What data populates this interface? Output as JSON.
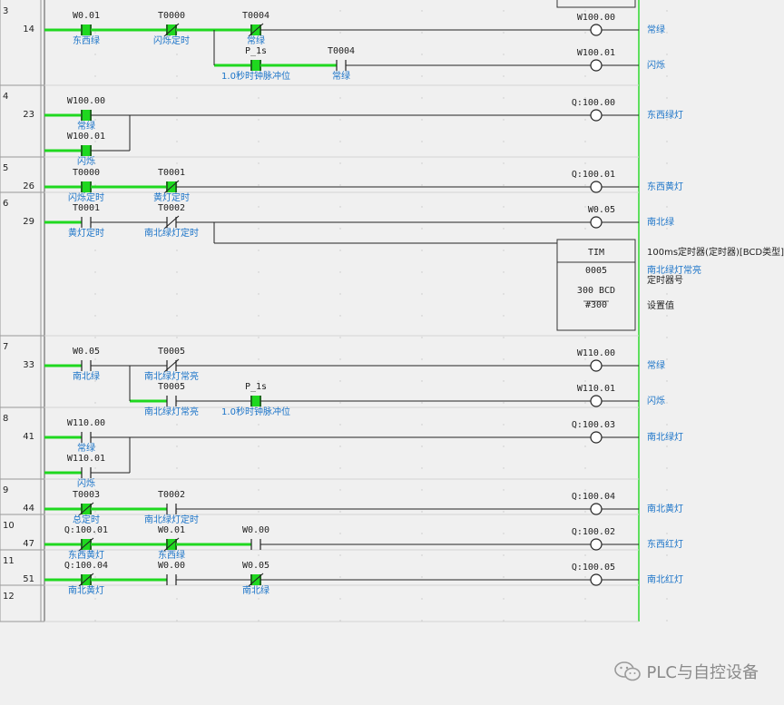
{
  "rungs": [
    {
      "id": "3",
      "step": "14",
      "elements": [
        {
          "kind": "contact",
          "row": 0,
          "col": 0,
          "addr": "W0.01",
          "cmt": "东西绿",
          "energized": true
        },
        {
          "kind": "nc",
          "row": 0,
          "col": 1,
          "addr": "T0000",
          "cmt": "闪烁定时",
          "energized": true
        },
        {
          "kind": "nc",
          "row": 0,
          "col": 2,
          "addr": "T0004",
          "cmt": "常绿",
          "energized": true
        },
        {
          "kind": "coil",
          "row": 0,
          "addr": "W100.00",
          "rcmt": "常绿"
        },
        {
          "kind": "contact",
          "row": 1,
          "col": 2,
          "addr": "P_1s",
          "cmt": "1.0秒时钟脉冲位",
          "energized": true
        },
        {
          "kind": "contact",
          "row": 1,
          "col": 3,
          "addr": "T0004",
          "cmt": "常绿",
          "energized": false
        },
        {
          "kind": "coil",
          "row": 1,
          "addr": "W100.01",
          "rcmt": "闪烁"
        }
      ]
    },
    {
      "id": "4",
      "step": "23",
      "elements": [
        {
          "kind": "contact",
          "row": 0,
          "col": 0,
          "addr": "W100.00",
          "cmt": "常绿",
          "energized": true
        },
        {
          "kind": "contact",
          "row": 1,
          "col": 0,
          "addr": "W100.01",
          "cmt": "闪烁",
          "energized": true
        },
        {
          "kind": "coil",
          "row": 0,
          "addr": "Q:100.00",
          "rcmt": "东西绿灯"
        }
      ]
    },
    {
      "id": "5",
      "step": "26",
      "elements": [
        {
          "kind": "contact",
          "row": 0,
          "col": 0,
          "addr": "T0000",
          "cmt": "闪烁定时",
          "energized": true
        },
        {
          "kind": "nc",
          "row": 0,
          "col": 1,
          "addr": "T0001",
          "cmt": "黄灯定时",
          "energized": true
        },
        {
          "kind": "coil",
          "row": 0,
          "addr": "Q:100.01",
          "rcmt": "东西黄灯"
        }
      ]
    },
    {
      "id": "6",
      "step": "29",
      "elements": [
        {
          "kind": "contact",
          "row": 0,
          "col": 0,
          "addr": "T0001",
          "cmt": "黄灯定时",
          "energized": false
        },
        {
          "kind": "nc",
          "row": 0,
          "col": 1,
          "addr": "T0002",
          "cmt": "南北绿灯定时",
          "energized": false
        },
        {
          "kind": "coil",
          "row": 0,
          "addr": "W0.05",
          "rcmt": "南北绿"
        }
      ]
    },
    {
      "id": "7",
      "step": "33",
      "elements": [
        {
          "kind": "contact",
          "row": 0,
          "col": 0,
          "addr": "W0.05",
          "cmt": "南北绿",
          "energized": false
        },
        {
          "kind": "nc",
          "row": 0,
          "col": 1,
          "addr": "T0005",
          "cmt": "南北绿灯常亮",
          "energized": false
        },
        {
          "kind": "coil",
          "row": 0,
          "addr": "W110.00",
          "rcmt": "常绿"
        },
        {
          "kind": "contact",
          "row": 1,
          "col": 1,
          "addr": "T0005",
          "cmt": "南北绿灯常亮",
          "energized": false
        },
        {
          "kind": "contact",
          "row": 1,
          "col": 2,
          "addr": "P_1s",
          "cmt": "1.0秒时钟脉冲位",
          "energized": true
        },
        {
          "kind": "coil",
          "row": 1,
          "addr": "W110.01",
          "rcmt": "闪烁"
        }
      ]
    },
    {
      "id": "8",
      "step": "41",
      "elements": [
        {
          "kind": "contact",
          "row": 0,
          "col": 0,
          "addr": "W110.00",
          "cmt": "常绿",
          "energized": false
        },
        {
          "kind": "contact",
          "row": 1,
          "col": 0,
          "addr": "W110.01",
          "cmt": "闪烁",
          "energized": false
        },
        {
          "kind": "coil",
          "row": 0,
          "addr": "Q:100.03",
          "rcmt": "南北绿灯"
        }
      ]
    },
    {
      "id": "9",
      "step": "44",
      "elements": [
        {
          "kind": "nc",
          "row": 0,
          "col": 0,
          "addr": "T0003",
          "cmt": "总定时",
          "energized": true
        },
        {
          "kind": "contact",
          "row": 0,
          "col": 1,
          "addr": "T0002",
          "cmt": "南北绿灯定时",
          "energized": false
        },
        {
          "kind": "coil",
          "row": 0,
          "addr": "Q:100.04",
          "rcmt": "南北黄灯"
        }
      ]
    },
    {
      "id": "10",
      "step": "47",
      "elements": [
        {
          "kind": "nc",
          "row": 0,
          "col": 0,
          "addr": "Q:100.01",
          "cmt": "东西黄灯",
          "energized": true
        },
        {
          "kind": "nc",
          "row": 0,
          "col": 1,
          "addr": "W0.01",
          "cmt": "东西绿",
          "energized": true
        },
        {
          "kind": "contact",
          "row": 0,
          "col": 2,
          "addr": "W0.00",
          "cmt": "",
          "energized": false
        },
        {
          "kind": "coil",
          "row": 0,
          "addr": "Q:100.02",
          "rcmt": "东西红灯"
        }
      ]
    },
    {
      "id": "11",
      "step": "51",
      "elements": [
        {
          "kind": "nc",
          "row": 0,
          "col": 0,
          "addr": "Q:100.04",
          "cmt": "南北黄灯",
          "energized": true
        },
        {
          "kind": "contact",
          "row": 0,
          "col": 1,
          "addr": "W0.00",
          "cmt": "",
          "energized": false
        },
        {
          "kind": "nc",
          "row": 0,
          "col": 2,
          "addr": "W0.05",
          "cmt": "南北绿",
          "energized": true
        },
        {
          "kind": "coil",
          "row": 0,
          "addr": "Q:100.05",
          "rcmt": "南北红灯"
        }
      ]
    },
    {
      "id": "12",
      "step": "",
      "elements": []
    }
  ],
  "timer_block": {
    "instr": "TIM",
    "num": "0005",
    "set": "300 BCD",
    "preset": "#300",
    "desc": "100ms定时器(定时器)[BCD类型]",
    "num_cmt": "南北绿灯常亮",
    "num_label": "定时器号",
    "set_label": "设置值"
  },
  "watermark": "PLC与自控设备",
  "colors": {
    "energized": "#1fd81f",
    "line": "#222222",
    "comment": "#1a73c8",
    "background": "#f0f0f0"
  }
}
